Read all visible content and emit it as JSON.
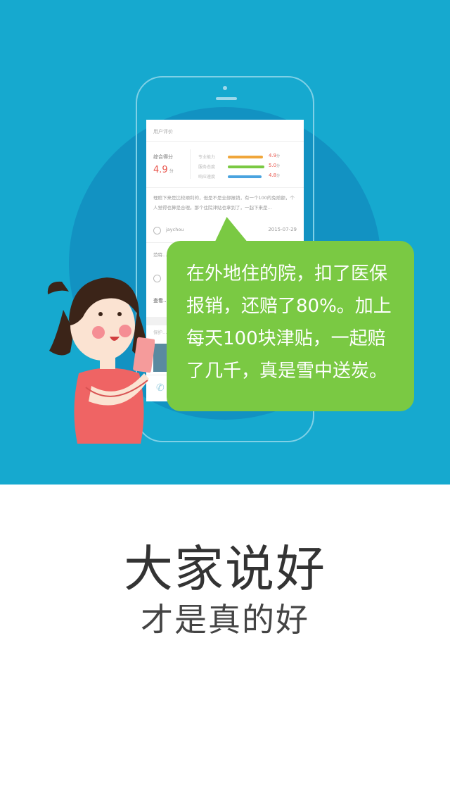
{
  "hero": {
    "colors": {
      "background": "#16a9cf",
      "circle": "#1292c2",
      "bubble": "#7ac943"
    }
  },
  "phone_screen": {
    "header": "用户评价",
    "score_label": "综合得分",
    "score_value": "4.9",
    "score_unit": "分",
    "metrics": [
      {
        "label": "专业能力",
        "value": "4.9",
        "unit": "分",
        "color": "#f0a63a"
      },
      {
        "label": "服务态度",
        "value": "5.0",
        "unit": "分",
        "color": "#7ac943"
      },
      {
        "label": "响应速度",
        "value": "4.8",
        "unit": "分",
        "color": "#4aa3df"
      }
    ],
    "review_text": "理赔下来是比较顺利的，但是不是全部报销，有一个100的免赔额，个人觉得也算是合理。那个住院津贴也拿到了，一起下来是…",
    "reviewer": "jaychou",
    "review_date": "2015-07-29",
    "review2_text": "范特…",
    "more_label": "查看…",
    "blur_text": "保护…",
    "phone_icon": "phone-icon"
  },
  "bubble": {
    "text": "在外地住的院，扣了医保\n报销，还赔了80%。加上\n每天100块津贴，一起赔\n了几千，真是雪中送炭。"
  },
  "tagline": {
    "headline": "大家说好",
    "subline": "才是真的好"
  }
}
